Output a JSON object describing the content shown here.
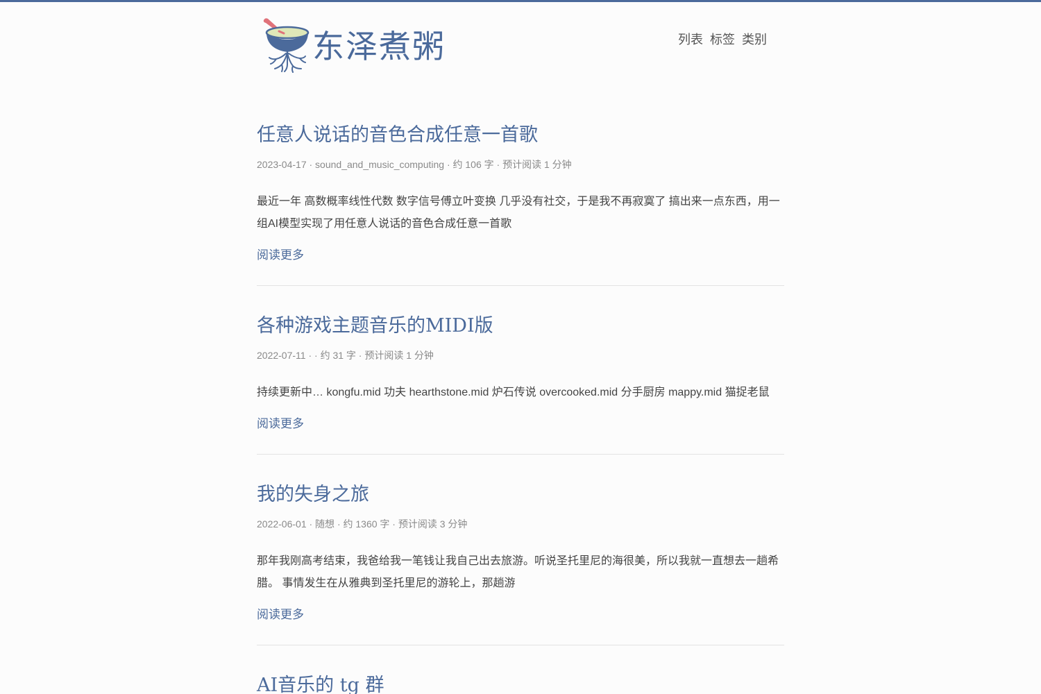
{
  "site": {
    "name": "东泽煮粥",
    "logo_icon": "porridge-bowl-logo-icon"
  },
  "nav": {
    "items": [
      {
        "label": "列表"
      },
      {
        "label": "标签"
      },
      {
        "label": "类别"
      }
    ]
  },
  "posts": [
    {
      "title": "任意人说话的音色合成任意一首歌",
      "meta": "2023-04-17 · sound_and_music_computing · 约 106 字 · 预计阅读 1 分钟",
      "summary": "最近一年 高数概率线性代数 数字信号傅立叶变换 几乎没有社交，于是我不再寂寞了 搞出来一点东西，用一组AI模型实现了用任意人说话的音色合成任意一首歌",
      "more": "阅读更多"
    },
    {
      "title": "各种游戏主题音乐的MIDI版",
      "meta": "2022-07-11 · · 约 31 字 · 预计阅读 1 分钟",
      "summary": "持续更新中… kongfu.mid 功夫 hearthstone.mid 炉石传说 overcooked.mid 分手厨房 mappy.mid 猫捉老鼠",
      "more": "阅读更多"
    },
    {
      "title": "我的失身之旅",
      "meta": "2022-06-01 · 随想 · 约 1360 字 · 预计阅读 3 分钟",
      "summary": "那年我刚高考结束，我爸给我一笔钱让我自己出去旅游。听说圣托里尼的海很美，所以我就一直想去一趟希腊。 事情发生在从雅典到圣托里尼的游轮上，那趟游",
      "more": "阅读更多"
    },
    {
      "title": "AI音乐的 tg 群"
    }
  ],
  "colors": {
    "accent": "#4b6a9b",
    "text": "#444444",
    "meta": "#8a8a8a",
    "divider": "#e3e3e3",
    "spoon": "#e0727a",
    "bowl_fill": "#dfe8b8"
  }
}
